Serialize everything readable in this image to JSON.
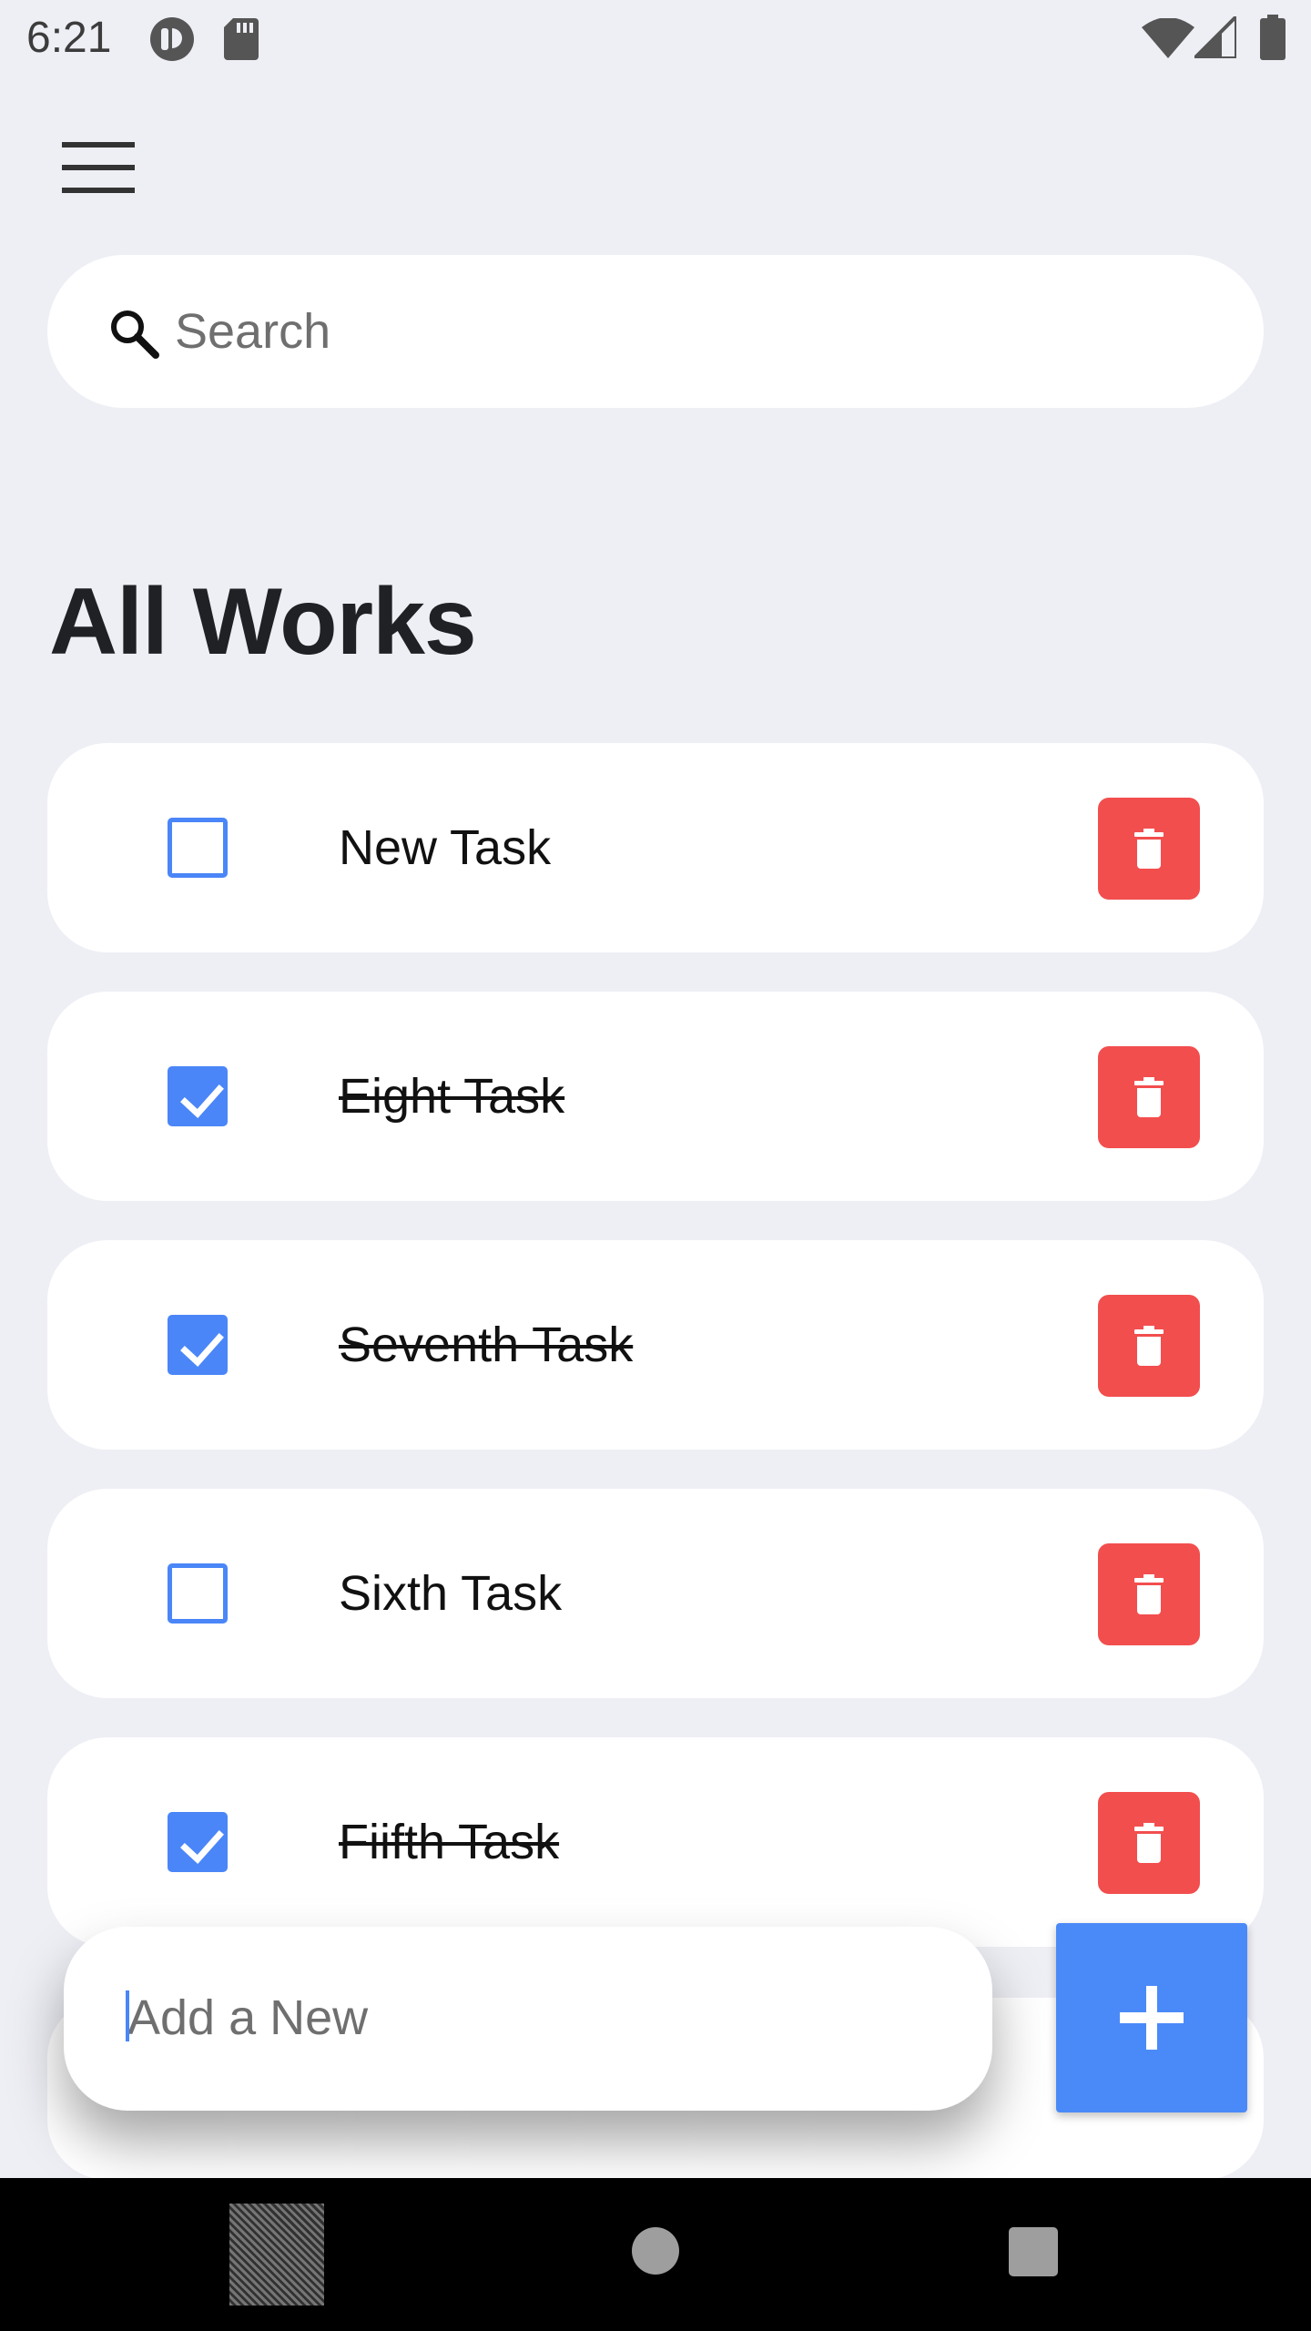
{
  "status_bar": {
    "time": "6:21",
    "left_icons": [
      "headset-app-icon",
      "sd-card-icon"
    ],
    "right_icons": [
      "wifi-icon",
      "cell-signal-icon",
      "battery-icon"
    ]
  },
  "header": {
    "menu_icon": "hamburger-menu-icon"
  },
  "search": {
    "icon": "search-icon",
    "placeholder": "Search",
    "value": ""
  },
  "main": {
    "title": "All Works",
    "tasks": [
      {
        "label": "New Task",
        "done": false
      },
      {
        "label": "Eight Task",
        "done": true
      },
      {
        "label": "Seventh Task",
        "done": true
      },
      {
        "label": "Sixth Task",
        "done": false
      },
      {
        "label": "Fiifth Task",
        "done": true
      }
    ],
    "delete_icon": "trash-icon"
  },
  "add_bar": {
    "placeholder": "Add a New",
    "value": "",
    "button_icon": "plus-icon"
  },
  "nav_bar": {
    "items": [
      "back-button",
      "home-button",
      "recents-button"
    ]
  },
  "colors": {
    "background": "#EEEFF5",
    "accent": "#4A86F7",
    "delete": "#F24E4E",
    "card": "#FFFFFF"
  }
}
